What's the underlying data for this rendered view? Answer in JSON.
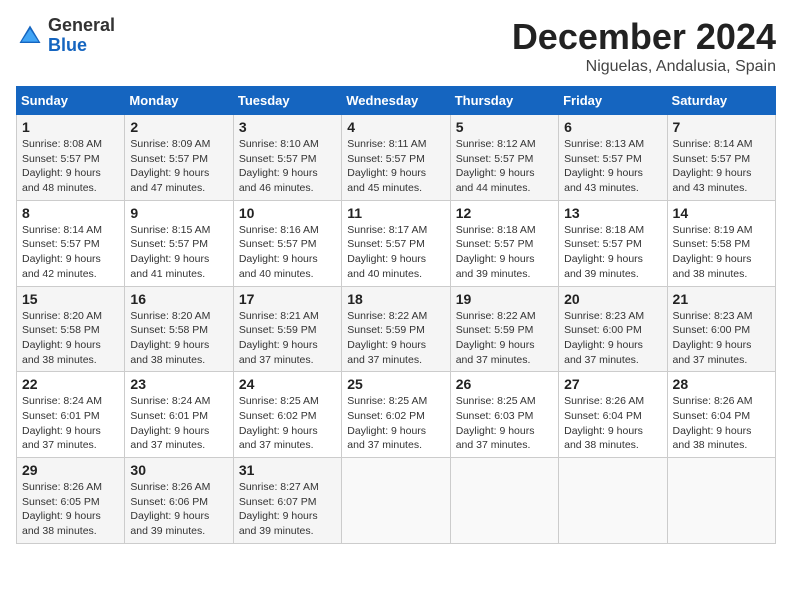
{
  "logo": {
    "general": "General",
    "blue": "Blue"
  },
  "title": "December 2024",
  "location": "Niguelas, Andalusia, Spain",
  "days_header": [
    "Sunday",
    "Monday",
    "Tuesday",
    "Wednesday",
    "Thursday",
    "Friday",
    "Saturday"
  ],
  "weeks": [
    [
      {
        "day": "1",
        "sunrise": "8:08 AM",
        "sunset": "5:57 PM",
        "daylight": "9 hours and 48 minutes."
      },
      {
        "day": "2",
        "sunrise": "8:09 AM",
        "sunset": "5:57 PM",
        "daylight": "9 hours and 47 minutes."
      },
      {
        "day": "3",
        "sunrise": "8:10 AM",
        "sunset": "5:57 PM",
        "daylight": "9 hours and 46 minutes."
      },
      {
        "day": "4",
        "sunrise": "8:11 AM",
        "sunset": "5:57 PM",
        "daylight": "9 hours and 45 minutes."
      },
      {
        "day": "5",
        "sunrise": "8:12 AM",
        "sunset": "5:57 PM",
        "daylight": "9 hours and 44 minutes."
      },
      {
        "day": "6",
        "sunrise": "8:13 AM",
        "sunset": "5:57 PM",
        "daylight": "9 hours and 43 minutes."
      },
      {
        "day": "7",
        "sunrise": "8:14 AM",
        "sunset": "5:57 PM",
        "daylight": "9 hours and 43 minutes."
      }
    ],
    [
      {
        "day": "8",
        "sunrise": "8:14 AM",
        "sunset": "5:57 PM",
        "daylight": "9 hours and 42 minutes."
      },
      {
        "day": "9",
        "sunrise": "8:15 AM",
        "sunset": "5:57 PM",
        "daylight": "9 hours and 41 minutes."
      },
      {
        "day": "10",
        "sunrise": "8:16 AM",
        "sunset": "5:57 PM",
        "daylight": "9 hours and 40 minutes."
      },
      {
        "day": "11",
        "sunrise": "8:17 AM",
        "sunset": "5:57 PM",
        "daylight": "9 hours and 40 minutes."
      },
      {
        "day": "12",
        "sunrise": "8:18 AM",
        "sunset": "5:57 PM",
        "daylight": "9 hours and 39 minutes."
      },
      {
        "day": "13",
        "sunrise": "8:18 AM",
        "sunset": "5:57 PM",
        "daylight": "9 hours and 39 minutes."
      },
      {
        "day": "14",
        "sunrise": "8:19 AM",
        "sunset": "5:58 PM",
        "daylight": "9 hours and 38 minutes."
      }
    ],
    [
      {
        "day": "15",
        "sunrise": "8:20 AM",
        "sunset": "5:58 PM",
        "daylight": "9 hours and 38 minutes."
      },
      {
        "day": "16",
        "sunrise": "8:20 AM",
        "sunset": "5:58 PM",
        "daylight": "9 hours and 38 minutes."
      },
      {
        "day": "17",
        "sunrise": "8:21 AM",
        "sunset": "5:59 PM",
        "daylight": "9 hours and 37 minutes."
      },
      {
        "day": "18",
        "sunrise": "8:22 AM",
        "sunset": "5:59 PM",
        "daylight": "9 hours and 37 minutes."
      },
      {
        "day": "19",
        "sunrise": "8:22 AM",
        "sunset": "5:59 PM",
        "daylight": "9 hours and 37 minutes."
      },
      {
        "day": "20",
        "sunrise": "8:23 AM",
        "sunset": "6:00 PM",
        "daylight": "9 hours and 37 minutes."
      },
      {
        "day": "21",
        "sunrise": "8:23 AM",
        "sunset": "6:00 PM",
        "daylight": "9 hours and 37 minutes."
      }
    ],
    [
      {
        "day": "22",
        "sunrise": "8:24 AM",
        "sunset": "6:01 PM",
        "daylight": "9 hours and 37 minutes."
      },
      {
        "day": "23",
        "sunrise": "8:24 AM",
        "sunset": "6:01 PM",
        "daylight": "9 hours and 37 minutes."
      },
      {
        "day": "24",
        "sunrise": "8:25 AM",
        "sunset": "6:02 PM",
        "daylight": "9 hours and 37 minutes."
      },
      {
        "day": "25",
        "sunrise": "8:25 AM",
        "sunset": "6:02 PM",
        "daylight": "9 hours and 37 minutes."
      },
      {
        "day": "26",
        "sunrise": "8:25 AM",
        "sunset": "6:03 PM",
        "daylight": "9 hours and 37 minutes."
      },
      {
        "day": "27",
        "sunrise": "8:26 AM",
        "sunset": "6:04 PM",
        "daylight": "9 hours and 38 minutes."
      },
      {
        "day": "28",
        "sunrise": "8:26 AM",
        "sunset": "6:04 PM",
        "daylight": "9 hours and 38 minutes."
      }
    ],
    [
      {
        "day": "29",
        "sunrise": "8:26 AM",
        "sunset": "6:05 PM",
        "daylight": "9 hours and 38 minutes."
      },
      {
        "day": "30",
        "sunrise": "8:26 AM",
        "sunset": "6:06 PM",
        "daylight": "9 hours and 39 minutes."
      },
      {
        "day": "31",
        "sunrise": "8:27 AM",
        "sunset": "6:07 PM",
        "daylight": "9 hours and 39 minutes."
      },
      null,
      null,
      null,
      null
    ]
  ]
}
